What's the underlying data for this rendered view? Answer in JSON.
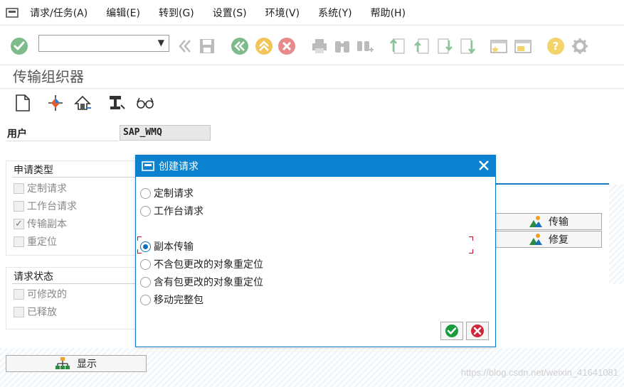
{
  "menu": {
    "items": [
      "请求/任务(A)",
      "编辑(E)",
      "转到(G)",
      "设置(S)",
      "环境(V)",
      "系统(Y)",
      "帮助(H)"
    ]
  },
  "toolbar": {
    "command_field_value": ""
  },
  "page": {
    "title": "传输组织器"
  },
  "user": {
    "label": "用户",
    "value": "SAP_WMQ"
  },
  "request_type_group": {
    "title": "申请类型",
    "options": [
      {
        "label": "定制请求",
        "checked": false
      },
      {
        "label": "工作台请求",
        "checked": false
      },
      {
        "label": "传输副本",
        "checked": true
      },
      {
        "label": "重定位",
        "checked": false
      }
    ]
  },
  "request_status_group": {
    "title": "请求状态",
    "options": [
      {
        "label": "可修改的",
        "checked": false
      },
      {
        "label": "已释放",
        "checked": false
      }
    ]
  },
  "right_buttons": {
    "transport_label": "传输",
    "repair_label": "修复"
  },
  "display_button": {
    "label": "显示"
  },
  "dialog": {
    "title": "创建请求",
    "options": [
      {
        "label": "定制请求",
        "selected": false
      },
      {
        "label": "工作台请求",
        "selected": false
      },
      {
        "label": "副本传输",
        "selected": true
      },
      {
        "label": "不含包更改的对象重定位",
        "selected": false
      },
      {
        "label": "含有包更改的对象重定位",
        "selected": false
      },
      {
        "label": "移动完整包",
        "selected": false
      }
    ]
  },
  "watermark": "https://blog.csdn.net/weixin_41641081",
  "colors": {
    "accent": "#0a82cf",
    "ok_green": "#1a9c3e",
    "cancel_red": "#d0263b"
  }
}
